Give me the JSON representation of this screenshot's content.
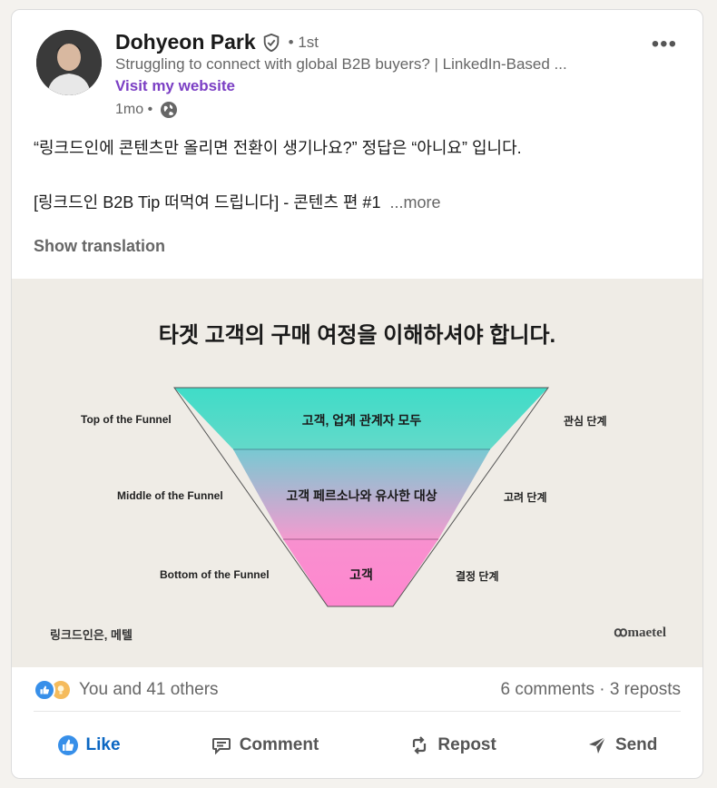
{
  "post": {
    "author_name": "Dohyeon Park",
    "degree": "• 1st",
    "headline": "Struggling to connect with global B2B buyers? | LinkedIn-Based ...",
    "website_label": "Visit my website",
    "time": "1mo •",
    "more_icon": "more-horizontal-icon",
    "text_line1": "“링크드인에 콘텐츠만 올리면 전환이 생기나요?” 정답은 “아니요” 입니다.",
    "text_line2": "[링크드인 B2B Tip 떠먹여 드립니다] - 콘텐츠 편 #1",
    "see_more": "...more",
    "show_translation": "Show translation"
  },
  "image": {
    "title": "타겟 고객의 구매 여정을 이해하셔야 합니다.",
    "stages": [
      {
        "left_label": "Top of the Funnel",
        "center": "고객, 업계 관계자 모두",
        "right_label": "관심 단계",
        "color_top": "#3fdcc8",
        "color_bottom": "#63d9c9"
      },
      {
        "left_label": "Middle of the Funnel",
        "center": "고객 페르소나와 유사한 대상",
        "right_label": "고려 단계",
        "color_top": "#78c9d2",
        "color_bottom": "#f39bcf"
      },
      {
        "left_label": "Bottom of the Funnel",
        "center": "고객",
        "right_label": "결정 단계",
        "color_top": "#f890cf",
        "color_bottom": "#ff86cf"
      }
    ],
    "footer_left": "링크드인은, 메텔",
    "footer_right": "ꝏmaetel"
  },
  "social": {
    "reactions_text": "You and 41 others",
    "counts_text": "6 comments · 3 reposts",
    "reaction_icons": [
      "like-reaction-icon",
      "insightful-reaction-icon"
    ]
  },
  "actions": {
    "like": "Like",
    "comment": "Comment",
    "repost": "Repost",
    "send": "Send"
  },
  "colors": {
    "link_purple": "#7b3fc4",
    "like_blue": "#0a66c2"
  }
}
